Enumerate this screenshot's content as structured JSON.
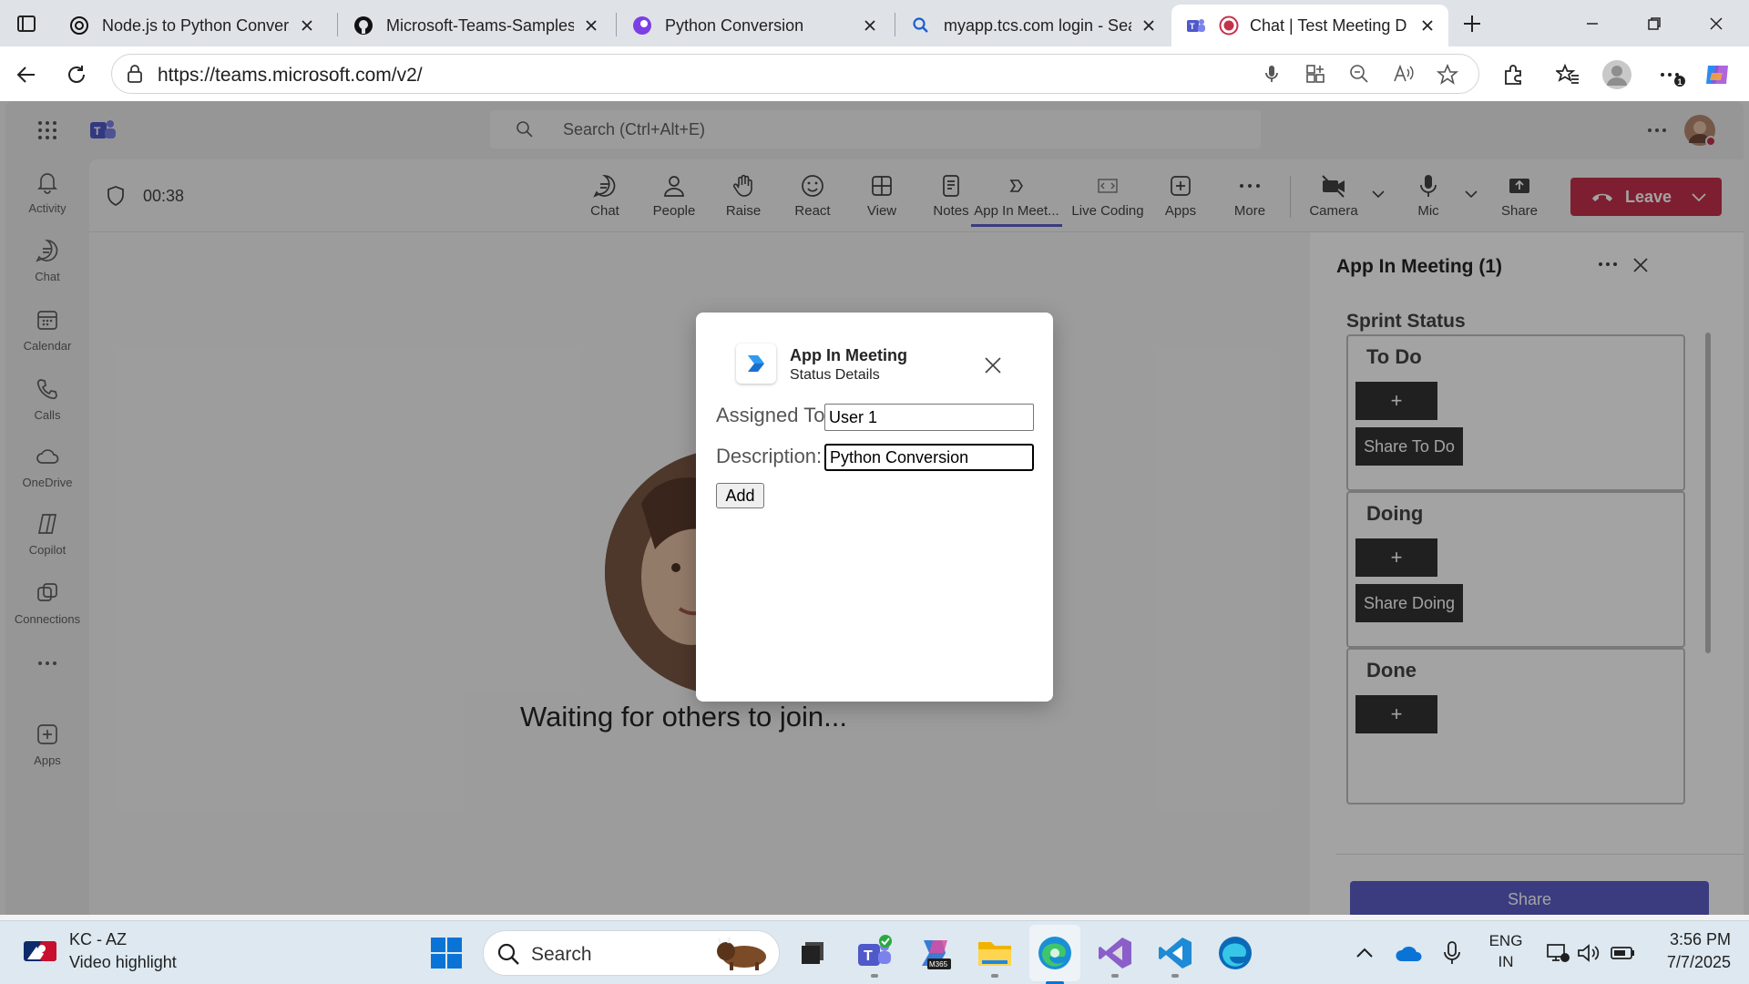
{
  "browser": {
    "tabs": [
      {
        "title": "Node.js to Python Convers",
        "icon": "chatgpt-icon"
      },
      {
        "title": "Microsoft-Teams-Samples/",
        "icon": "github-icon"
      },
      {
        "title": "Python Conversion",
        "icon": "copilot-icon"
      },
      {
        "title": "myapp.tcs.com login - Sear",
        "icon": "search-icon"
      },
      {
        "title": "Chat | Test Meeting D",
        "icon": "teams-icon",
        "active": true
      }
    ],
    "url": "https://teams.microsoft.com/v2/"
  },
  "teams": {
    "search_placeholder": "Search (Ctrl+Alt+E)",
    "rail": [
      {
        "label": "Activity",
        "icon": "bell-icon"
      },
      {
        "label": "Chat",
        "icon": "chat-icon"
      },
      {
        "label": "Calendar",
        "icon": "calendar-icon"
      },
      {
        "label": "Calls",
        "icon": "phone-icon"
      },
      {
        "label": "OneDrive",
        "icon": "cloud-icon"
      },
      {
        "label": "Copilot",
        "icon": "copilot-icon"
      },
      {
        "label": "Connections",
        "icon": "connections-icon"
      },
      {
        "label": "Apps",
        "icon": "apps-icon"
      }
    ],
    "timer": "00:38",
    "meeting_controls": [
      {
        "label": "Chat",
        "icon": "chat-icon"
      },
      {
        "label": "People",
        "icon": "people-icon"
      },
      {
        "label": "Raise",
        "icon": "hand-icon"
      },
      {
        "label": "React",
        "icon": "smile-icon"
      },
      {
        "label": "View",
        "icon": "view-icon"
      },
      {
        "label": "Notes",
        "icon": "notes-icon"
      },
      {
        "label": "App In Meet...",
        "icon": "app-icon"
      },
      {
        "label": "Live Coding",
        "icon": "code-icon"
      },
      {
        "label": "Apps",
        "icon": "add-icon"
      },
      {
        "label": "More",
        "icon": "more-icon"
      }
    ],
    "device_controls": [
      {
        "label": "Camera",
        "icon": "camera-off-icon"
      },
      {
        "label": "Mic",
        "icon": "mic-icon"
      },
      {
        "label": "Share",
        "icon": "share-icon"
      }
    ],
    "leave_label": "Leave",
    "waiting_text": "Waiting for others to join...",
    "panel": {
      "title": "App In Meeting (1)",
      "section_title": "Sprint Status",
      "columns": [
        {
          "title": "To Do",
          "add_label": "+",
          "share_label": "Share To Do"
        },
        {
          "title": "Doing",
          "add_label": "+",
          "share_label": "Share Doing"
        },
        {
          "title": "Done",
          "add_label": "+"
        }
      ],
      "share_label": "Share"
    }
  },
  "dialog": {
    "title": "App In Meeting",
    "subtitle": "Status Details",
    "assigned_label": "Assigned To:",
    "assigned_value": "User 1",
    "description_label": "Description:",
    "description_value": "Python Conversion",
    "add_label": "Add"
  },
  "taskbar": {
    "weather_title": "KC - AZ",
    "weather_subtitle": "Video highlight",
    "search_label": "Search",
    "language_line1": "ENG",
    "language_line2": "IN",
    "time": "3:56 PM",
    "date": "7/7/2025"
  }
}
